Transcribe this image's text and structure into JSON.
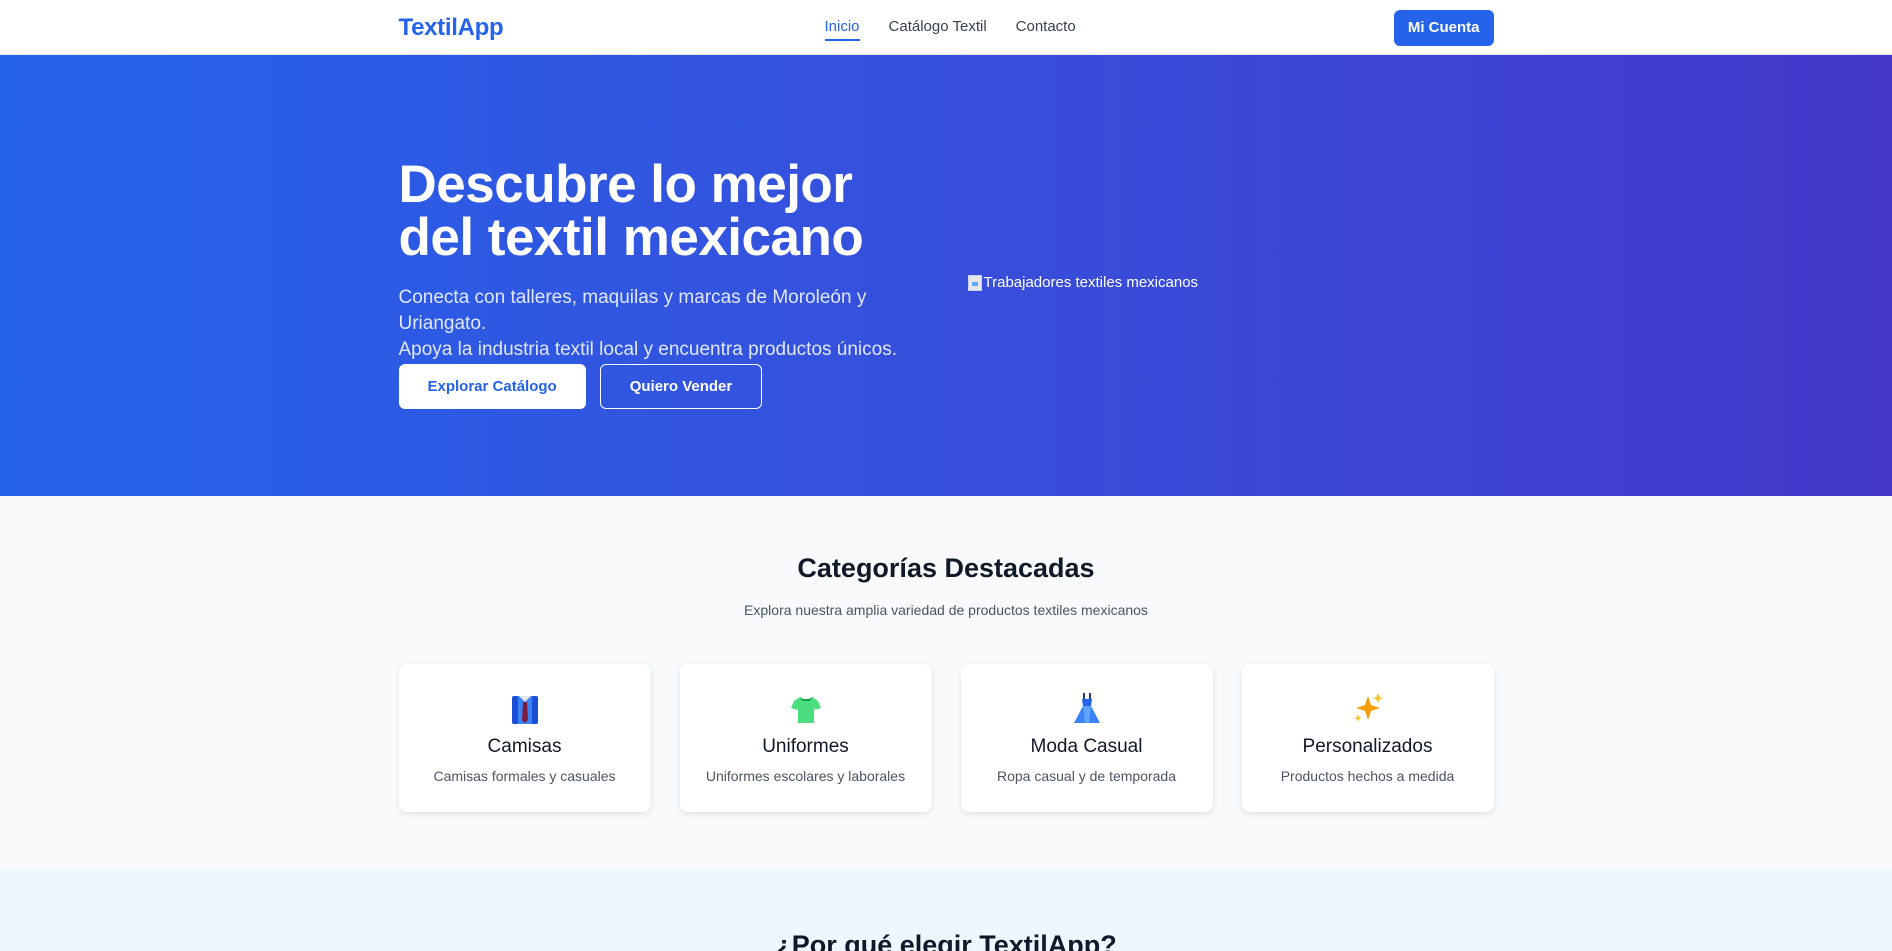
{
  "navbar": {
    "logo": "TextilApp",
    "links": [
      {
        "label": "Inicio",
        "active": true
      },
      {
        "label": "Catálogo Textil",
        "active": false
      },
      {
        "label": "Contacto",
        "active": false
      }
    ],
    "account_button": "Mi Cuenta"
  },
  "hero": {
    "title_line1": "Descubre lo mejor",
    "title_line2": "del textil mexicano",
    "subtitle_line1": "Conecta con talleres, maquilas y marcas de Moroleón y Uriangato.",
    "subtitle_line2": "Apoya la industria textil local y encuentra productos únicos.",
    "primary_button": "Explorar Catálogo",
    "secondary_button": "Quiero Vender",
    "image_alt": "Trabajadores textiles mexicanos"
  },
  "categories": {
    "title": "Categorías Destacadas",
    "subtitle": "Explora nuestra amplia variedad de productos textiles mexicanos",
    "items": [
      {
        "icon": "shirt-tie-icon",
        "title": "Camisas",
        "description": "Camisas formales y casuales"
      },
      {
        "icon": "tshirt-icon",
        "title": "Uniformes",
        "description": "Uniformes escolares y laborales"
      },
      {
        "icon": "dress-icon",
        "title": "Moda Casual",
        "description": "Ropa casual y de temporada"
      },
      {
        "icon": "sparkles-icon",
        "title": "Personalizados",
        "description": "Productos hechos a medida"
      }
    ]
  },
  "why": {
    "title": "¿Por qué elegir TextilApp?"
  },
  "colors": {
    "brand": "#2563eb",
    "hero_gradient_start": "#2563eb",
    "hero_gradient_end": "#4338ca"
  }
}
